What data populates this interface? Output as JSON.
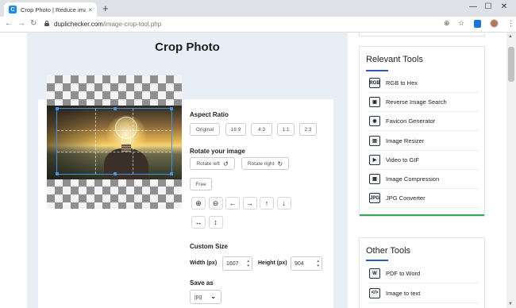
{
  "browser": {
    "tab_title": "Crop Photo | Reduce image size",
    "tab_close_icon": "×",
    "new_tab_icon": "+",
    "favicon_letter": "C",
    "window_controls": {
      "minimize": "—",
      "maximize": "☐",
      "close": "✕"
    },
    "nav": {
      "back": "←",
      "forward": "→",
      "reload": "↻"
    },
    "url_domain": "duplichecker.com",
    "url_path": "/image-crop-tool.php",
    "addr_icons": {
      "translate": "⊕",
      "star": "☆",
      "menu": "⋮"
    }
  },
  "page": {
    "title": "Crop Photo"
  },
  "tool": {
    "aspect_ratio_label": "Aspect Ratio",
    "aspect_options": [
      "Original",
      "16:9",
      "4:3",
      "1:1",
      "2:3"
    ],
    "rotate_label": "Rotate your image",
    "rotate_left": "Rotate left",
    "rotate_left_glyph": "↺",
    "rotate_right": "Rotate right",
    "rotate_right_glyph": "↻",
    "free_label": "Free",
    "icon_buttons_row1": [
      "zoom-in",
      "zoom-out",
      "move-left",
      "move-right",
      "move-up",
      "move-down"
    ],
    "icon_glyphs_row1": [
      "⊕",
      "⊖",
      "←",
      "→",
      "↑",
      "↓"
    ],
    "icon_buttons_row2": [
      "flip-horizontal",
      "flip-vertical"
    ],
    "icon_glyphs_row2": [
      "↔",
      "↕"
    ],
    "custom_size_label": "Custom Size",
    "width_label": "Width (px)",
    "width_value": "1607",
    "height_label": "Height (px)",
    "height_value": "904",
    "spin_glyph": "▲▼",
    "save_as_label": "Save as",
    "format_value": "jpg",
    "format_arrow": "⌄"
  },
  "sidebar": {
    "relevant_title": "Relevant Tools",
    "relevant_items": [
      {
        "label": "RGB to Hex",
        "icon": "rgb-hex-icon",
        "glyph": "RGB"
      },
      {
        "label": "Reverse Image Search",
        "icon": "image-search-icon",
        "glyph": "▣"
      },
      {
        "label": "Favicon Generator",
        "icon": "favicon-icon",
        "glyph": "◉"
      },
      {
        "label": "Image Resizer",
        "icon": "image-resize-icon",
        "glyph": "▤"
      },
      {
        "label": "Video to GIF",
        "icon": "video-gif-icon",
        "glyph": "▶"
      },
      {
        "label": "Image Compression",
        "icon": "image-compress-icon",
        "glyph": "▦"
      },
      {
        "label": "JPG Converter",
        "icon": "jpg-converter-icon",
        "glyph": "JPG"
      }
    ],
    "other_title": "Other Tools",
    "other_items": [
      {
        "label": "PDF to Word",
        "icon": "pdf-word-icon",
        "glyph": "W"
      },
      {
        "label": "Image to text",
        "icon": "image-text-icon",
        "glyph": "</>"
      }
    ]
  },
  "scrollbar": {
    "up": "▲",
    "down": "▼"
  },
  "colors": {
    "accent_blue": "#2a5db0",
    "accent_green": "#34a853",
    "page_bg": "#e8eef5",
    "crop_border": "#4a90e2"
  }
}
